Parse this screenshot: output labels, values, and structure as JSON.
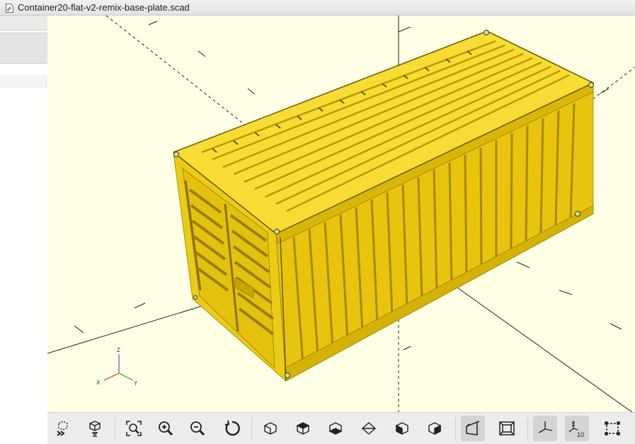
{
  "window": {
    "title": "Container20-flat-v2-remix-base-plate.scad"
  },
  "viewport": {
    "background": "#ffffe5",
    "model_color": "#f7d41a",
    "axes_indicator": {
      "x": "X",
      "y": "Y",
      "z": "Z"
    }
  },
  "toolbar": {
    "buttons": [
      {
        "name": "preview-button",
        "icon": "preview-icon"
      },
      {
        "name": "render-button",
        "icon": "render-icon"
      },
      {
        "name": "view-all-button",
        "icon": "zoom-all-icon"
      },
      {
        "name": "zoom-in-button",
        "icon": "zoom-in-icon"
      },
      {
        "name": "zoom-out-button",
        "icon": "zoom-out-icon"
      },
      {
        "name": "reset-view-button",
        "icon": "reset-view-icon"
      },
      {
        "name": "view-right-button",
        "icon": "view-right-icon"
      },
      {
        "name": "view-top-button",
        "icon": "view-top-icon"
      },
      {
        "name": "view-bottom-button",
        "icon": "view-bottom-icon"
      },
      {
        "name": "view-left-button",
        "icon": "view-left-icon"
      },
      {
        "name": "view-front-button",
        "icon": "view-front-icon"
      },
      {
        "name": "view-back-button",
        "icon": "view-back-icon"
      },
      {
        "name": "perspective-button",
        "icon": "perspective-icon",
        "active": true
      },
      {
        "name": "orthogonal-button",
        "icon": "orthogonal-icon"
      },
      {
        "name": "show-axes-button",
        "icon": "axes-icon",
        "active": true
      },
      {
        "name": "show-scale-button",
        "icon": "scale-markers-icon",
        "active": true
      },
      {
        "name": "show-edges-button",
        "icon": "edges-icon"
      }
    ],
    "scale_label": "10"
  }
}
